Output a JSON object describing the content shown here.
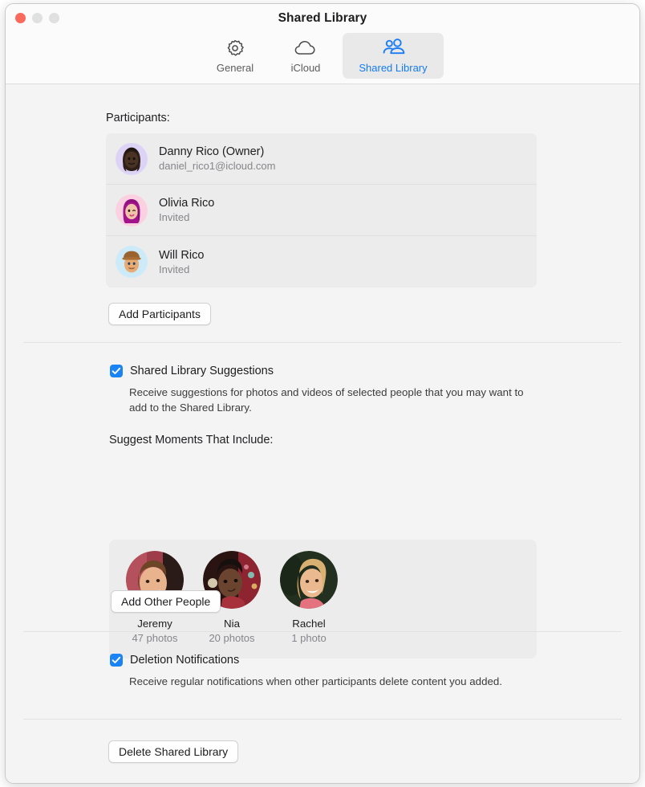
{
  "window": {
    "title": "Shared Library",
    "traffic_lights": [
      "close-button",
      "minimize-button",
      "zoom-button"
    ]
  },
  "toolbar": {
    "items": [
      {
        "label": "General",
        "icon": "gear-icon",
        "selected": false
      },
      {
        "label": "iCloud",
        "icon": "cloud-icon",
        "selected": false
      },
      {
        "label": "Shared Library",
        "icon": "people-icon",
        "selected": true
      }
    ],
    "selected_color": "#147cf0"
  },
  "participants_section": {
    "label": "Participants:",
    "rows": [
      {
        "name": "Danny Rico (Owner)",
        "meta": "daniel_rico1@icloud.com",
        "avatar": "memoji-danny"
      },
      {
        "name": "Olivia Rico",
        "meta": "Invited",
        "avatar": "memoji-olivia"
      },
      {
        "name": "Will Rico",
        "meta": "Invited",
        "avatar": "memoji-will"
      }
    ],
    "add_button": "Add Participants"
  },
  "suggestions_section": {
    "checkbox_label": "Shared Library Suggestions",
    "checkbox_checked": true,
    "description": "Receive suggestions for photos and videos of selected people that you may want to add to the Shared Library.",
    "people_label": "Suggest Moments That Include:",
    "people": [
      {
        "name": "Jeremy",
        "count": "47 photos"
      },
      {
        "name": "Nia",
        "count": "20 photos"
      },
      {
        "name": "Rachel",
        "count": "1 photo"
      }
    ],
    "add_button": "Add Other People"
  },
  "deletion_section": {
    "checkbox_label": "Deletion Notifications",
    "checkbox_checked": true,
    "description": "Receive regular notifications when other participants delete content you added."
  },
  "delete_section": {
    "button": "Delete Shared Library"
  }
}
